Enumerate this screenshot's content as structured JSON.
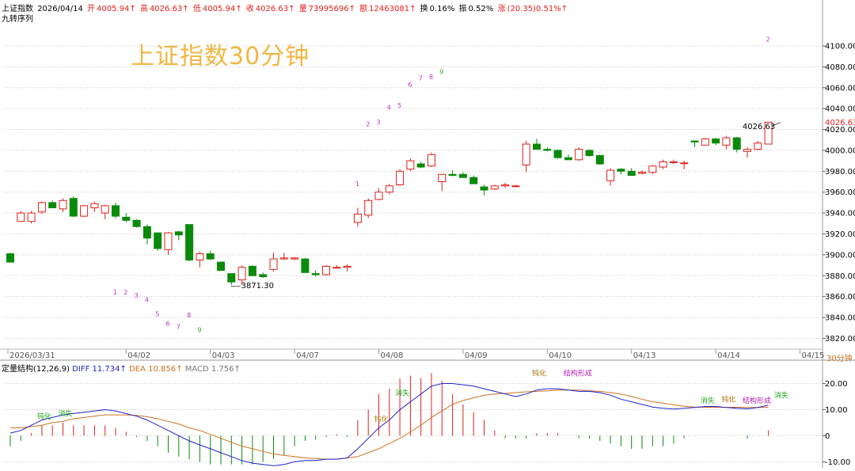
{
  "header": {
    "name": "上证指数",
    "date": "2026/04/14",
    "open_label": "开",
    "open": "4005.94↑",
    "high_label": "高",
    "high": "4026.63↑",
    "low_label": "低",
    "low": "4005.94↑",
    "close_label": "收",
    "close": "4026.63↑",
    "vol_label": "量",
    "vol": "73995696↑",
    "amount_label": "额",
    "amount": "12463081↑",
    "turnover_label": "换",
    "turnover": "0.16%",
    "amp_label": "振",
    "amp": "0.52%",
    "chg_label": "涨",
    "chg": "(20.35)0.51%↑"
  },
  "sub_label": "九转序列",
  "big_title": "上证指数30分钟",
  "period_label": "30分钟",
  "macd_header": {
    "name": "定量结构(12,26,9)",
    "diff_label": "DIFF",
    "diff": "11.734↑",
    "dea_label": "DEA",
    "dea": "10.856↑",
    "macd_label": "MACD",
    "macd": "1.756↑"
  },
  "colors": {
    "up": "#e0201b",
    "down": "#0a8a0a",
    "grid": "#c8c8c8",
    "title": "#f1b643",
    "diff": "#2222cc",
    "dea": "#d07020",
    "nine": "#c030c0",
    "nine_final": "#22aa22"
  },
  "chart_data": [
    {
      "type": "candlestick",
      "title": "上证指数30分钟",
      "y_ticks": [
        3820,
        3840,
        3860,
        3880,
        3900,
        3920,
        3940,
        3960,
        3980,
        4000,
        4020,
        4040,
        4060,
        4080,
        4100
      ],
      "y_tick_labels": [
        "3820.00",
        "3840.00",
        "3860.00",
        "3880.00",
        "3900.00",
        "3920.00",
        "3940.00",
        "3960.00",
        "3980.00",
        "4000.00",
        "4020.00",
        "4040.00",
        "4060.00",
        "4080.00",
        "4100.00"
      ],
      "ylim": [
        3812,
        4125
      ],
      "x_date_labels": [
        {
          "label": "2026/03/31",
          "index": 0
        },
        {
          "label": "04/02",
          "index": 11
        },
        {
          "label": "04/03",
          "index": 19
        },
        {
          "label": "04/07",
          "index": 27
        },
        {
          "label": "04/08",
          "index": 35
        },
        {
          "label": "04/09",
          "index": 43
        },
        {
          "label": "04/10",
          "index": 51
        },
        {
          "label": "04/13",
          "index": 59
        },
        {
          "label": "04/14",
          "index": 67
        },
        {
          "label": "04/15",
          "index": 75
        }
      ],
      "last_price": "4026.63",
      "annotations": [
        {
          "text": "4026.63",
          "index": 73,
          "value": 4026.63
        },
        {
          "text": "3871.30",
          "index": 22,
          "value": 3871.3
        }
      ],
      "ohlc": [
        [
          3901,
          3902,
          3893,
          3893
        ],
        [
          3932,
          3942,
          3932,
          3940
        ],
        [
          3932,
          3942,
          3930,
          3940
        ],
        [
          3941,
          3951,
          3939,
          3950
        ],
        [
          3950,
          3952,
          3945,
          3945
        ],
        [
          3944,
          3954,
          3941,
          3952
        ],
        [
          3954,
          3956,
          3936,
          3937
        ],
        [
          3937,
          3948,
          3936,
          3947
        ],
        [
          3945,
          3951,
          3941,
          3949
        ],
        [
          3940,
          3948,
          3934,
          3947
        ],
        [
          3947,
          3950,
          3935,
          3937
        ],
        [
          3936,
          3940,
          3931,
          3933
        ],
        [
          3933,
          3934,
          3926,
          3927
        ],
        [
          3927,
          3929,
          3910,
          3916
        ],
        [
          3921,
          3921,
          3904,
          3906
        ],
        [
          3905,
          3922,
          3900,
          3921
        ],
        [
          3922,
          3923,
          3914,
          3919
        ],
        [
          3929,
          3929,
          3894,
          3895
        ],
        [
          3895,
          3903,
          3888,
          3901
        ],
        [
          3901,
          3904,
          3895,
          3896
        ],
        [
          3893,
          3893,
          3885,
          3885
        ],
        [
          3882,
          3882,
          3871,
          3874
        ],
        [
          3876,
          3890,
          3871,
          3888
        ],
        [
          3889,
          3890,
          3880,
          3880
        ],
        [
          3881,
          3883,
          3878,
          3879
        ],
        [
          3886,
          3902,
          3884,
          3896
        ],
        [
          3896,
          3902,
          3895,
          3897
        ],
        [
          3896,
          3898,
          3895,
          3897
        ],
        [
          3896,
          3897,
          3883,
          3883
        ],
        [
          3882,
          3885,
          3879,
          3881
        ],
        [
          3881,
          3890,
          3880,
          3889
        ],
        [
          3888,
          3890,
          3887,
          3888
        ],
        [
          3888,
          3891,
          3884,
          3889
        ],
        [
          3931,
          3945,
          3927,
          3939
        ],
        [
          3938,
          3954,
          3935,
          3952
        ],
        [
          3953,
          3964,
          3952,
          3960
        ],
        [
          3960,
          3968,
          3958,
          3966
        ],
        [
          3967,
          3982,
          3966,
          3980
        ],
        [
          3982,
          3992,
          3980,
          3990
        ],
        [
          3987,
          3989,
          3983,
          3984
        ],
        [
          3985,
          3998,
          3984,
          3996
        ],
        [
          3970,
          3977,
          3961,
          3977
        ],
        [
          3977,
          3981,
          3975,
          3976
        ],
        [
          3977,
          3979,
          3974,
          3974
        ],
        [
          3974,
          3976,
          3968,
          3968
        ],
        [
          3965,
          3967,
          3957,
          3962
        ],
        [
          3963,
          3967,
          3962,
          3966
        ],
        [
          3966,
          3969,
          3964,
          3967
        ],
        [
          3966,
          3967,
          3965,
          3966
        ],
        [
          3986,
          4009,
          3979,
          4006
        ],
        [
          4006,
          4011,
          4001,
          4001
        ],
        [
          4001,
          4003,
          3999,
          4000
        ],
        [
          4000,
          4001,
          3992,
          3993
        ],
        [
          3993,
          3996,
          3991,
          3991
        ],
        [
          3991,
          4003,
          3990,
          4001
        ],
        [
          4000,
          4001,
          3994,
          3995
        ],
        [
          3995,
          3996,
          3986,
          3987
        ],
        [
          3971,
          3983,
          3966,
          3981
        ],
        [
          3982,
          3983,
          3977,
          3980
        ],
        [
          3980,
          3983,
          3976,
          3976
        ],
        [
          3978,
          3981,
          3977,
          3979
        ],
        [
          3979,
          3986,
          3977,
          3985
        ],
        [
          3984,
          3991,
          3982,
          3989
        ],
        [
          3989,
          3991,
          3987,
          3989
        ],
        [
          3988,
          3990,
          3982,
          3988
        ],
        [
          4009,
          4009,
          4003,
          4008
        ],
        [
          4005,
          4012,
          4005,
          4011
        ],
        [
          4011,
          4012,
          4005,
          4007
        ],
        [
          4005,
          4014,
          4001,
          4012
        ],
        [
          4012,
          4013,
          3998,
          4001
        ],
        [
          3999,
          4003,
          3993,
          4001
        ],
        [
          4001,
          4009,
          4000,
          4007
        ],
        [
          4006,
          4027,
          4006,
          4027
        ]
      ],
      "nine_sequence": [
        {
          "text": "1",
          "index": 10,
          "value": 3862,
          "final": false
        },
        {
          "text": "2",
          "index": 11,
          "value": 3862,
          "final": false
        },
        {
          "text": "3",
          "index": 12,
          "value": 3859,
          "final": false
        },
        {
          "text": "4",
          "index": 13,
          "value": 3855,
          "final": false
        },
        {
          "text": "5",
          "index": 14,
          "value": 3841,
          "final": false
        },
        {
          "text": "6",
          "index": 15,
          "value": 3832,
          "final": false
        },
        {
          "text": "7",
          "index": 16,
          "value": 3829,
          "final": false
        },
        {
          "text": "8",
          "index": 17,
          "value": 3840,
          "final": false
        },
        {
          "text": "9",
          "index": 18,
          "value": 3826,
          "final": true
        },
        {
          "text": "1",
          "index": 33,
          "value": 3966,
          "final": false
        },
        {
          "text": "2",
          "index": 34,
          "value": 4023,
          "final": false
        },
        {
          "text": "3",
          "index": 35,
          "value": 4025,
          "final": false
        },
        {
          "text": "4",
          "index": 36,
          "value": 4039,
          "final": false
        },
        {
          "text": "5",
          "index": 37,
          "value": 4041,
          "final": false
        },
        {
          "text": "6",
          "index": 38,
          "value": 4061,
          "final": false
        },
        {
          "text": "7",
          "index": 39,
          "value": 4067,
          "final": false
        },
        {
          "text": "8",
          "index": 40,
          "value": 4068,
          "final": false
        },
        {
          "text": "9",
          "index": 41,
          "value": 4073,
          "final": true
        },
        {
          "text": "2",
          "index": 72,
          "value": 4104,
          "final": false
        }
      ]
    },
    {
      "type": "line+bar",
      "title": "定量结构(12,26,9)",
      "y_ticks": [
        -10,
        0,
        10,
        20
      ],
      "y_tick_labels": [
        "-10.00",
        "0",
        "10.00",
        "20.00"
      ],
      "ylim": [
        -12,
        25
      ],
      "series": [
        {
          "name": "DIFF",
          "values": [
            1,
            2,
            4,
            6,
            7,
            8,
            8.5,
            9,
            9.5,
            10,
            9.5,
            8.5,
            7.5,
            6,
            4,
            2,
            0,
            -2,
            -3.5,
            -5,
            -6.5,
            -8,
            -9.5,
            -10.5,
            -11,
            -11.5,
            -11,
            -10,
            -9.5,
            -9.5,
            -9,
            -9,
            -8.5,
            -5,
            -1,
            3,
            6,
            10,
            13,
            16,
            19,
            20,
            20,
            19.5,
            19,
            18,
            17,
            16,
            15,
            16,
            17.5,
            18,
            18,
            17.5,
            17,
            17,
            16.5,
            15.5,
            14,
            13,
            12,
            11,
            10.5,
            10.2,
            10.5,
            10.8,
            11.2,
            11.2,
            10.8,
            10.5,
            10.3,
            10.8,
            11.7
          ]
        },
        {
          "name": "DEA",
          "values": [
            3,
            3,
            3.5,
            4,
            5,
            5.5,
            6.5,
            7,
            7.5,
            8,
            8,
            8,
            7.8,
            7.3,
            6.5,
            5.5,
            4.5,
            3,
            2,
            0.5,
            -1,
            -2.5,
            -4,
            -5,
            -6,
            -7,
            -7.5,
            -8,
            -8.5,
            -8.8,
            -9,
            -9,
            -8.5,
            -8,
            -6.5,
            -5,
            -3,
            -1,
            1.5,
            4,
            7,
            9.5,
            12,
            13.5,
            14.5,
            15.5,
            16,
            16.2,
            16.5,
            16.8,
            17,
            17.2,
            17.5,
            17.5,
            17.5,
            17.2,
            17,
            16.5,
            16,
            15,
            14,
            13,
            12.5,
            11.8,
            11.3,
            11,
            10.9,
            10.9,
            10.9,
            10.9,
            10.8,
            10.8,
            10.9
          ]
        },
        {
          "name": "MACD",
          "values": [
            -4,
            -2,
            1,
            4,
            4,
            5,
            4,
            4,
            4,
            4,
            3,
            1.5,
            -0.5,
            -2,
            -4,
            -6.5,
            -8,
            -9,
            -10,
            -11,
            -11,
            -11,
            -11,
            -11,
            -10,
            -9,
            -7.5,
            -4,
            -2,
            -1.5,
            -0.5,
            0.5,
            -0.5,
            6,
            10,
            16,
            18,
            22,
            23,
            22,
            24,
            21,
            16,
            12,
            9,
            6,
            2,
            -1,
            -1,
            -1,
            1,
            1,
            1,
            0,
            -1,
            -1,
            -2,
            -3,
            -4,
            -5,
            -5,
            -4,
            -4,
            -3,
            -1,
            0,
            0,
            0,
            0,
            0,
            -1,
            0,
            2
          ]
        }
      ],
      "annotations": [
        {
          "text": "钝化",
          "index": 3,
          "value": 6.5,
          "color": "green"
        },
        {
          "text": "消失",
          "index": 5,
          "value": 7.5,
          "color": "green"
        },
        {
          "text": "钝化",
          "index": 35,
          "value": 5.5,
          "color": "orange"
        },
        {
          "text": "消失",
          "index": 37,
          "value": 15.5,
          "color": "green"
        },
        {
          "text": "钝化",
          "index": 50,
          "value": 23,
          "color": "orange"
        },
        {
          "text": "结构形成",
          "index": 53,
          "value": 23,
          "color": "magenta"
        },
        {
          "text": "消失",
          "index": 66,
          "value": 12.5,
          "color": "green"
        },
        {
          "text": "钝化",
          "index": 68,
          "value": 13,
          "color": "orange"
        },
        {
          "text": "结构形成",
          "index": 70,
          "value": 12.5,
          "color": "magenta"
        },
        {
          "text": "消失",
          "index": 73,
          "value": 14.5,
          "color": "green"
        }
      ]
    }
  ]
}
